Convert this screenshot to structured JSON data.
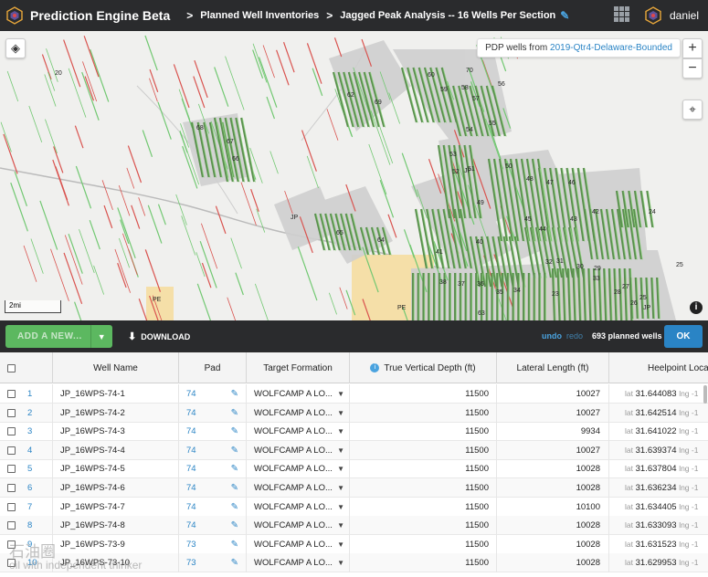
{
  "header": {
    "app_title": "Prediction Engine Beta",
    "breadcrumbs": [
      "Planned Well Inventories",
      "Jagged Peak Analysis -- 16 Wells Per Section"
    ],
    "separator": ">",
    "username": "daniel",
    "edit_icon": "pencil-icon",
    "apps_icon": "grid-icon"
  },
  "map": {
    "pdp_prefix": "PDP wells from ",
    "pdp_link": "2019-Qtr4-Delaware-Bounded",
    "zoom_in": "+",
    "zoom_out": "−",
    "scale_label": "2mi",
    "info_icon": "i",
    "labels": [
      "60",
      "59",
      "58",
      "57",
      "56",
      "55",
      "54",
      "53",
      "52",
      "51",
      "50",
      "49",
      "48",
      "47",
      "46",
      "45",
      "44",
      "43",
      "42",
      "41",
      "40",
      "38",
      "37",
      "36",
      "35",
      "34",
      "33",
      "32",
      "31",
      "30",
      "29",
      "28",
      "27",
      "26",
      "25",
      "24",
      "23",
      "62",
      "63",
      "64",
      "65",
      "66",
      "67",
      "68",
      "69",
      "70",
      "JP",
      "JP",
      "JP",
      "PE",
      "PE",
      "20",
      "25"
    ],
    "colors": {
      "planned": "#5fa55a",
      "pdp_red": "#d9534f",
      "pdp_green": "#72c872",
      "land": "#c8c8c8",
      "orange": "#f5d9a0"
    }
  },
  "actions": {
    "add_new": "ADD A NEW...",
    "download": "DOWNLOAD",
    "undo": "undo",
    "redo": "redo",
    "planned_count": "693 planned wells",
    "ok": "OK"
  },
  "table": {
    "columns": [
      "Well Name",
      "Pad",
      "Target Formation",
      "True Vertical Depth (ft)",
      "Lateral Length (ft)",
      "Heelpoint Loca"
    ],
    "rows": [
      {
        "n": "1",
        "name": "JP_16WPS-74-1",
        "pad": "74",
        "formation": "WOLFCAMP A LO...",
        "tvd": "11500",
        "lat_len": "10027",
        "lat": "31.644083",
        "lng": "lng -1"
      },
      {
        "n": "2",
        "name": "JP_16WPS-74-2",
        "pad": "74",
        "formation": "WOLFCAMP A LO...",
        "tvd": "11500",
        "lat_len": "10027",
        "lat": "31.642514",
        "lng": "lng -1"
      },
      {
        "n": "3",
        "name": "JP_16WPS-74-3",
        "pad": "74",
        "formation": "WOLFCAMP A LO...",
        "tvd": "11500",
        "lat_len": "9934",
        "lat": "31.641022",
        "lng": "lng -1"
      },
      {
        "n": "4",
        "name": "JP_16WPS-74-4",
        "pad": "74",
        "formation": "WOLFCAMP A LO...",
        "tvd": "11500",
        "lat_len": "10027",
        "lat": "31.639374",
        "lng": "lng -1"
      },
      {
        "n": "5",
        "name": "JP_16WPS-74-5",
        "pad": "74",
        "formation": "WOLFCAMP A LO...",
        "tvd": "11500",
        "lat_len": "10028",
        "lat": "31.637804",
        "lng": "lng -1"
      },
      {
        "n": "6",
        "name": "JP_16WPS-74-6",
        "pad": "74",
        "formation": "WOLFCAMP A LO...",
        "tvd": "11500",
        "lat_len": "10028",
        "lat": "31.636234",
        "lng": "lng -1"
      },
      {
        "n": "7",
        "name": "JP_16WPS-74-7",
        "pad": "74",
        "formation": "WOLFCAMP A LO...",
        "tvd": "11500",
        "lat_len": "10100",
        "lat": "31.634405",
        "lng": "lng -1"
      },
      {
        "n": "8",
        "name": "JP_16WPS-74-8",
        "pad": "74",
        "formation": "WOLFCAMP A LO...",
        "tvd": "11500",
        "lat_len": "10028",
        "lat": "31.633093",
        "lng": "lng -1"
      },
      {
        "n": "9",
        "name": "JP_16WPS-73-9",
        "pad": "73",
        "formation": "WOLFCAMP A LO...",
        "tvd": "11500",
        "lat_len": "10028",
        "lat": "31.631523",
        "lng": "lng -1"
      },
      {
        "n": "10",
        "name": "JP_16WPS-73-10",
        "pad": "73",
        "formation": "WOLFCAMP A LO...",
        "tvd": "11500",
        "lat_len": "10028",
        "lat": "31.629953",
        "lng": "lng -1"
      }
    ],
    "lat_prefix": "lat"
  },
  "watermark": {
    "line1": "石油圈",
    "line2": "oil with independent thinker"
  }
}
